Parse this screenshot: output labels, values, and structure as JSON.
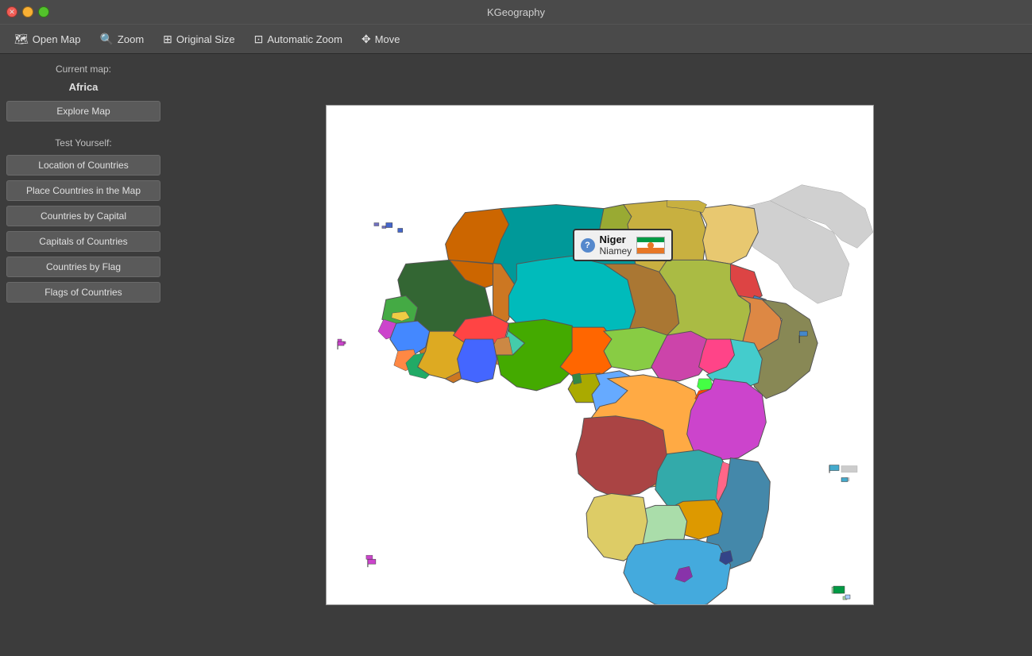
{
  "titlebar": {
    "title": "KGeography",
    "controls": {
      "close": "✕",
      "minimize": "",
      "maximize": ""
    }
  },
  "toolbar": {
    "items": [
      {
        "label": "Open Map",
        "icon": "🗺"
      },
      {
        "label": "Zoom",
        "icon": "🔍"
      },
      {
        "label": "Original Size",
        "icon": "⊞"
      },
      {
        "label": "Automatic Zoom",
        "icon": "⊡"
      },
      {
        "label": "Move",
        "icon": "✥"
      }
    ]
  },
  "sidebar": {
    "current_map_label": "Current map:",
    "current_map_value": "Africa",
    "explore_button": "Explore Map",
    "test_label": "Test Yourself:",
    "test_buttons": [
      "Location of Countries",
      "Place Countries in the Map",
      "Countries by Capital",
      "Capitals of Countries",
      "Countries by Flag",
      "Flags of Countries"
    ]
  },
  "tooltip": {
    "country": "Niger",
    "capital": "Niamey",
    "question_icon": "?"
  }
}
